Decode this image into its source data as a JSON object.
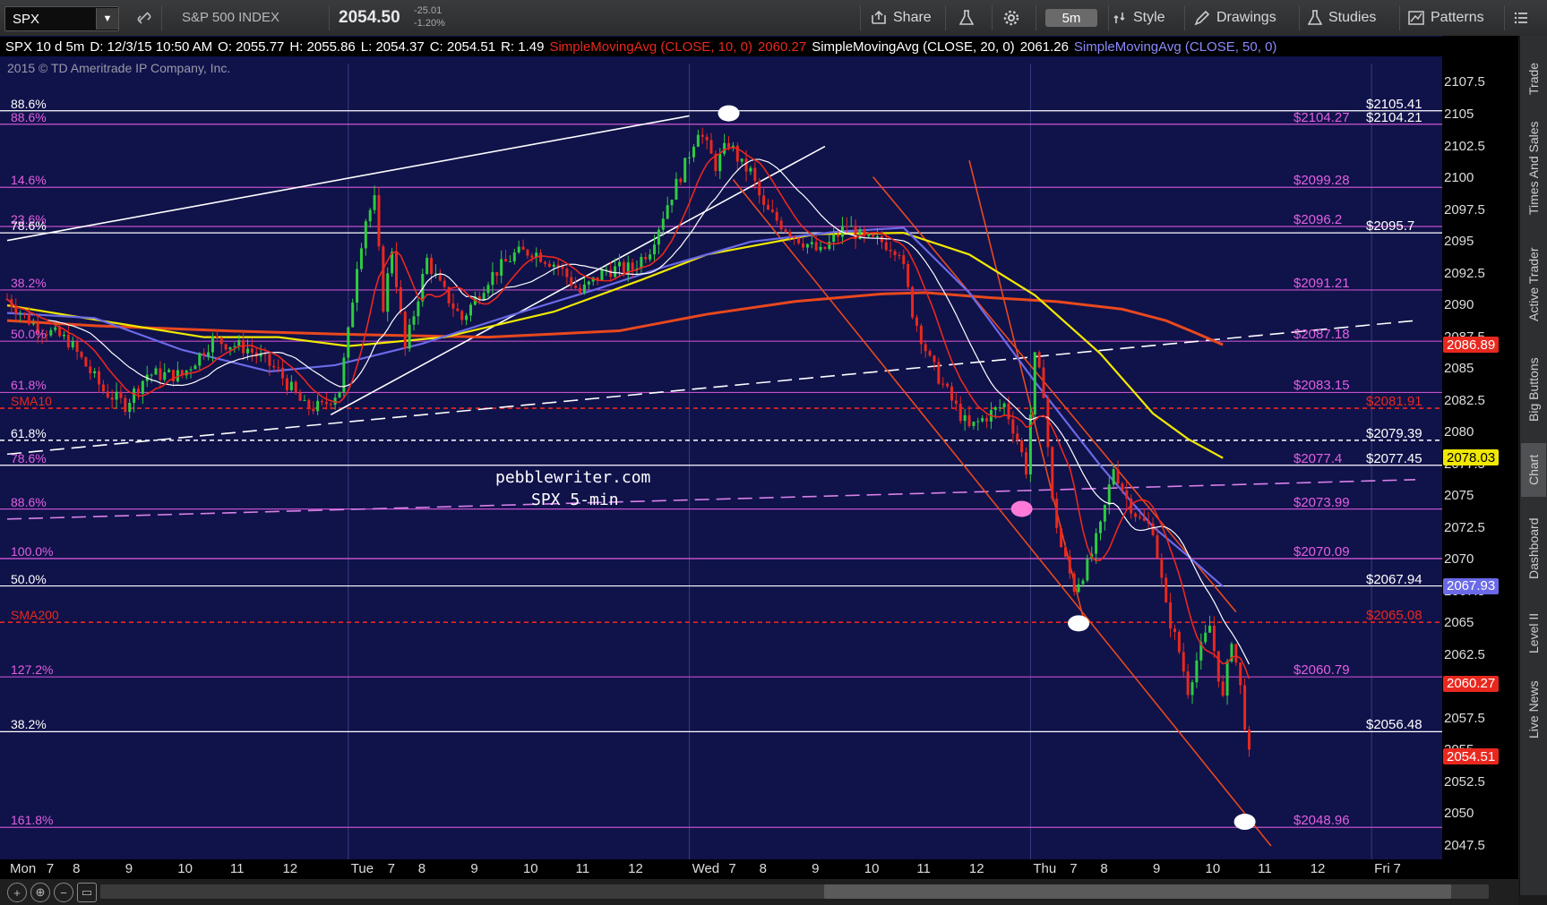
{
  "toolbar": {
    "symbol": "SPX",
    "symbol_desc": "S&P 500 INDEX",
    "last_price": "2054.50",
    "net_change": "-25.01",
    "pct_change": "-1.20%",
    "timeframe": "5m",
    "share_label": "Share",
    "style_label": "Style",
    "drawings_label": "Drawings",
    "studies_label": "Studies",
    "patterns_label": "Patterns"
  },
  "info_bar": {
    "chart_desc": "SPX 10 d 5m",
    "date": "D: 12/3/15 10:50 AM",
    "open": "O: 2055.77",
    "high": "H: 2055.86",
    "low": "L: 2054.37",
    "close": "C: 2054.51",
    "range": "R: 1.49",
    "sma10_label": "SimpleMovingAvg (CLOSE, 10, 0)",
    "sma10_value": "2060.27",
    "sma20_label": "SimpleMovingAvg (CLOSE, 20, 0)",
    "sma20_value": "2061.26",
    "sma50_label": "SimpleMovingAvg (CLOSE, 50, 0)"
  },
  "copyright": "2015 © TD Ameritrade IP Company, Inc.",
  "watermark": {
    "line1": "pebblewriter.com",
    "line2": "SPX 5-min"
  },
  "y_axis": {
    "min": 2045.5,
    "max": 2109,
    "ticks": [
      2107.5,
      2105,
      2102.5,
      2100,
      2097.5,
      2095,
      2092.5,
      2090,
      2087.5,
      2085,
      2082.5,
      2080,
      2077.5,
      2075,
      2072.5,
      2070,
      2067.5,
      2065,
      2062.5,
      2060,
      2057.5,
      2055,
      2052.5,
      2050,
      2047.5
    ]
  },
  "price_tags": [
    {
      "label": "2086.89",
      "value": 2086.89,
      "bg": "#e8281e",
      "fg": "#ffffff"
    },
    {
      "label": "2078.03",
      "value": 2078.03,
      "bg": "#f0e800",
      "fg": "#000000"
    },
    {
      "label": "2067.93",
      "value": 2067.93,
      "bg": "#6a6ae8",
      "fg": "#ffffff"
    },
    {
      "label": "2060.27",
      "value": 2060.27,
      "bg": "#e8281e",
      "fg": "#ffffff"
    },
    {
      "label": "2054.51",
      "value": 2054.51,
      "bg": "#e8281e",
      "fg": "#ffffff"
    }
  ],
  "levels": [
    {
      "value": 2105.3,
      "left": "88.6%",
      "right": "$2105.41",
      "rclass": "white",
      "color": "#ffffff",
      "style": "solid",
      "left_color": "#ffffff"
    },
    {
      "value": 2104.24,
      "left": "88.6%",
      "right": "$2104.21",
      "rclass": "white",
      "color": "#e060e0",
      "style": "solid",
      "left_color": "#e060e0",
      "mid": "$2104.27"
    },
    {
      "value": 2099.28,
      "left": "14.6%",
      "right": "",
      "color": "#c050c8",
      "style": "solid",
      "left_color": "#e060e0",
      "mid": "$2099.28"
    },
    {
      "value": 2096.2,
      "left": "23.6%",
      "right": "",
      "color": "#c050c8",
      "style": "solid",
      "left_color": "#e060e0",
      "mid": "$2096.2"
    },
    {
      "value": 2095.7,
      "left": "78.6%",
      "right": "$2095.7",
      "color": "#ffffff",
      "style": "solid",
      "left_color": "#ffffff"
    },
    {
      "value": 2091.21,
      "left": "38.2%",
      "right": "",
      "color": "#c050c8",
      "style": "solid",
      "left_color": "#e060e0",
      "mid": "$2091.21"
    },
    {
      "value": 2087.18,
      "left": "50.0%",
      "right": "",
      "color": "#c050c8",
      "style": "solid",
      "left_color": "#e060e0",
      "mid": "$2087.18"
    },
    {
      "value": 2083.15,
      "left": "61.8%",
      "right": "",
      "color": "#c050c8",
      "style": "solid",
      "left_color": "#e060e0",
      "mid": "$2083.15"
    },
    {
      "value": 2081.91,
      "left": "SMA10",
      "right": "$2081.91",
      "color": "#e8281e",
      "style": "dashed",
      "left_color": "#e8281e"
    },
    {
      "value": 2079.39,
      "left": "61.8%",
      "right": "$2079.39",
      "color": "#ffffff",
      "style": "dashed",
      "left_color": "#ffffff"
    },
    {
      "value": 2077.43,
      "left": "78.6%",
      "right": "$2077.45",
      "color": "#ffffff",
      "style": "solid",
      "left_color": "#e060e0",
      "mid": "$2077.4"
    },
    {
      "value": 2073.99,
      "left": "88.6%",
      "right": "",
      "color": "#c050c8",
      "style": "solid",
      "left_color": "#e060e0",
      "mid": "$2073.99"
    },
    {
      "value": 2070.09,
      "left": "100.0%",
      "right": "",
      "color": "#e060e0",
      "style": "solid",
      "left_color": "#e060e0",
      "mid": "$2070.09"
    },
    {
      "value": 2067.94,
      "left": "50.0%",
      "right": "$2067.94",
      "color": "#ffffff",
      "style": "solid",
      "left_color": "#ffffff"
    },
    {
      "value": 2065.08,
      "left": "SMA200",
      "right": "$2065.08",
      "color": "#e8281e",
      "style": "dashed",
      "left_color": "#e8281e"
    },
    {
      "value": 2060.79,
      "left": "127.2%",
      "right": "",
      "color": "#c050c8",
      "style": "solid",
      "left_color": "#e060e0",
      "mid": "$2060.79"
    },
    {
      "value": 2056.48,
      "left": "38.2%",
      "right": "$2056.48",
      "color": "#ffffff",
      "style": "solid",
      "left_color": "#ffffff"
    },
    {
      "value": 2048.96,
      "left": "161.8%",
      "right": "",
      "color": "#c050c8",
      "style": "solid",
      "left_color": "#e060e0",
      "mid": "$2048.96"
    }
  ],
  "x_axis": [
    {
      "label": "Mon",
      "bar": 0
    },
    {
      "label": "7",
      "bar": 10
    },
    {
      "label": "8",
      "bar": 16
    },
    {
      "label": "9",
      "bar": 28
    },
    {
      "label": "10",
      "bar": 40
    },
    {
      "label": "11",
      "bar": 52
    },
    {
      "label": "12",
      "bar": 64
    },
    {
      "label": "Tue",
      "bar": 78
    },
    {
      "label": "7",
      "bar": 88
    },
    {
      "label": "8",
      "bar": 95
    },
    {
      "label": "9",
      "bar": 107
    },
    {
      "label": "10",
      "bar": 119
    },
    {
      "label": "11",
      "bar": 131
    },
    {
      "label": "12",
      "bar": 143
    },
    {
      "label": "Wed",
      "bar": 156
    },
    {
      "label": "7",
      "bar": 166
    },
    {
      "label": "8",
      "bar": 173
    },
    {
      "label": "9",
      "bar": 185
    },
    {
      "label": "10",
      "bar": 197
    },
    {
      "label": "11",
      "bar": 209
    },
    {
      "label": "12",
      "bar": 221
    },
    {
      "label": "Thu",
      "bar": 234
    },
    {
      "label": "7",
      "bar": 244
    },
    {
      "label": "8",
      "bar": 251
    },
    {
      "label": "9",
      "bar": 263
    },
    {
      "label": "10",
      "bar": 275
    },
    {
      "label": "11",
      "bar": 287
    },
    {
      "label": "12",
      "bar": 299
    },
    {
      "label": "Fri",
      "bar": 312
    },
    {
      "label": "7",
      "bar": 318
    }
  ],
  "side_tabs": [
    "Trade",
    "Times And Sales",
    "Active Trader",
    "Big Buttons",
    "Chart",
    "Dashboard",
    "Level II",
    "Live News"
  ],
  "side_active": "Chart",
  "colors": {
    "background": "#10124a",
    "sma10": "#e8281e",
    "sma20": "#ffffff",
    "sma50": "#6a6ae8",
    "sma100": "#f0e800",
    "sma200": "#e8481e",
    "up_candle": "#2ecc40",
    "down_candle": "#e8281e",
    "fib_line": "#c050c8"
  },
  "chart_data": {
    "type": "line",
    "title": "SPX 10 d 5m",
    "x_domain_bars": [
      0,
      322
    ],
    "ylim": [
      2045.5,
      2109
    ],
    "price_path": [
      [
        0,
        2090.5
      ],
      [
        6,
        2088.5
      ],
      [
        14,
        2087.2
      ],
      [
        22,
        2083.3
      ],
      [
        27,
        2082.2
      ],
      [
        32,
        2084.6
      ],
      [
        40,
        2084.5
      ],
      [
        47,
        2087.3
      ],
      [
        55,
        2086.6
      ],
      [
        62,
        2084.8
      ],
      [
        68,
        2082.0
      ],
      [
        72,
        2082.0
      ],
      [
        76,
        2083.4
      ],
      [
        78,
        2087.8
      ],
      [
        80,
        2093.3
      ],
      [
        82,
        2096.8
      ],
      [
        84,
        2098.2
      ],
      [
        86,
        2090.0
      ],
      [
        88,
        2094.5
      ],
      [
        91,
        2086.5
      ],
      [
        96,
        2093.6
      ],
      [
        99,
        2091.5
      ],
      [
        104,
        2088.9
      ],
      [
        110,
        2092.1
      ],
      [
        116,
        2094.0
      ],
      [
        120,
        2094.3
      ],
      [
        126,
        2093.1
      ],
      [
        131,
        2091.0
      ],
      [
        137,
        2092.8
      ],
      [
        143,
        2092.9
      ],
      [
        147,
        2094.5
      ],
      [
        151,
        2098.0
      ],
      [
        155,
        2101.0
      ],
      [
        158,
        2103.9
      ],
      [
        162,
        2101.0
      ],
      [
        165,
        2102.8
      ],
      [
        168,
        2101.0
      ],
      [
        170,
        2100.5
      ],
      [
        173,
        2097.6
      ],
      [
        180,
        2095.5
      ],
      [
        186,
        2094.1
      ],
      [
        192,
        2096.3
      ],
      [
        196,
        2095.1
      ],
      [
        200,
        2095.0
      ],
      [
        204,
        2094.4
      ],
      [
        207,
        2089.5
      ],
      [
        211,
        2085.6
      ],
      [
        216,
        2082.5
      ],
      [
        220,
        2080.3
      ],
      [
        224,
        2081.3
      ],
      [
        228,
        2082.2
      ],
      [
        231,
        2079.5
      ],
      [
        233,
        2077.1
      ],
      [
        235,
        2085.8
      ],
      [
        237,
        2083.3
      ],
      [
        239,
        2074.5
      ],
      [
        241,
        2071.0
      ],
      [
        244,
        2067.8
      ],
      [
        247,
        2069.5
      ],
      [
        250,
        2072.5
      ],
      [
        253,
        2077.3
      ],
      [
        256,
        2074.8
      ],
      [
        259,
        2073.1
      ],
      [
        262,
        2072.5
      ],
      [
        265,
        2066.2
      ],
      [
        268,
        2062.8
      ],
      [
        270,
        2059.8
      ],
      [
        272,
        2062.1
      ],
      [
        275,
        2064.8
      ],
      [
        278,
        2059.0
      ],
      [
        280,
        2063.9
      ],
      [
        282,
        2059.9
      ],
      [
        284,
        2054.5
      ]
    ],
    "series": [
      {
        "name": "SimpleMovingAvg (CLOSE, 10, 0)",
        "last": 2060.27
      },
      {
        "name": "SimpleMovingAvg (CLOSE, 20, 0)",
        "last": 2061.26
      },
      {
        "name": "SimpleMovingAvg (CLOSE, 50, 0)",
        "last": 2067.93
      }
    ],
    "sma50": [
      [
        0,
        2089.4
      ],
      [
        20,
        2089.0
      ],
      [
        40,
        2086.5
      ],
      [
        60,
        2084.8
      ],
      [
        75,
        2085.3
      ],
      [
        95,
        2087.0
      ],
      [
        115,
        2089.2
      ],
      [
        135,
        2091.3
      ],
      [
        150,
        2093.0
      ],
      [
        170,
        2095.0
      ],
      [
        190,
        2095.8
      ],
      [
        205,
        2096.1
      ],
      [
        220,
        2091.0
      ],
      [
        235,
        2084.0
      ],
      [
        250,
        2077.4
      ],
      [
        262,
        2072.6
      ],
      [
        270,
        2070.3
      ],
      [
        278,
        2067.9
      ]
    ],
    "sma100": [
      [
        0,
        2090.0
      ],
      [
        25,
        2088.6
      ],
      [
        45,
        2087.5
      ],
      [
        62,
        2087.5
      ],
      [
        78,
        2086.8
      ],
      [
        100,
        2087.5
      ],
      [
        125,
        2089.5
      ],
      [
        145,
        2092.0
      ],
      [
        160,
        2094.0
      ],
      [
        185,
        2095.6
      ],
      [
        205,
        2095.7
      ],
      [
        220,
        2094.0
      ],
      [
        235,
        2090.8
      ],
      [
        250,
        2086.2
      ],
      [
        262,
        2081.5
      ],
      [
        270,
        2079.5
      ],
      [
        278,
        2078.0
      ]
    ],
    "sma200": [
      [
        0,
        2088.8
      ],
      [
        20,
        2088.4
      ],
      [
        50,
        2088.0
      ],
      [
        80,
        2087.7
      ],
      [
        110,
        2087.5
      ],
      [
        140,
        2088.0
      ],
      [
        160,
        2089.3
      ],
      [
        180,
        2090.3
      ],
      [
        200,
        2090.9
      ],
      [
        210,
        2091.0
      ],
      [
        225,
        2090.6
      ],
      [
        240,
        2090.3
      ],
      [
        255,
        2089.7
      ],
      [
        265,
        2088.8
      ],
      [
        272,
        2087.8
      ],
      [
        278,
        2086.9
      ]
    ],
    "trendlines": [
      {
        "from": [
          0,
          2095.1
        ],
        "to": [
          156,
          2104.9
        ],
        "color": "#ffffff",
        "style": "solid"
      },
      {
        "from": [
          74,
          2081.4
        ],
        "to": [
          187,
          2102.5
        ],
        "color": "#ffffff",
        "style": "solid"
      },
      {
        "from": [
          0,
          2078.3
        ],
        "to": [
          322,
          2088.8
        ],
        "color": "#ffffff",
        "style": "dashed"
      },
      {
        "from": [
          0,
          2073.2
        ],
        "to": [
          322,
          2076.3
        ],
        "color": "#d880e8",
        "style": "dashed"
      },
      {
        "from": [
          166,
          2099.9
        ],
        "to": [
          289,
          2047.5
        ],
        "color": "#e8481e",
        "style": "solid"
      },
      {
        "from": [
          198,
          2100.1
        ],
        "to": [
          281,
          2065.9
        ],
        "color": "#e8481e",
        "style": "solid"
      },
      {
        "from": [
          220,
          2101.4
        ],
        "to": [
          246,
          2065.5
        ],
        "color": "#e8481e",
        "style": "solid"
      }
    ]
  }
}
